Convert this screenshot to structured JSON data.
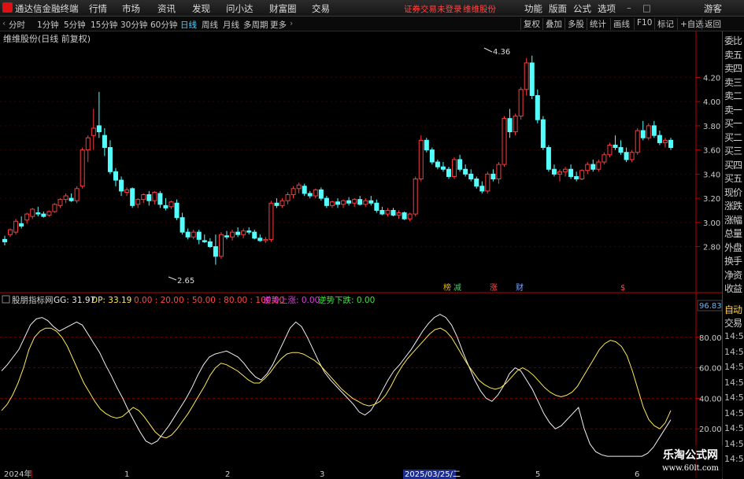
{
  "app": {
    "title": "通达信金融终端"
  },
  "menu": {
    "left": [
      "行情",
      "市场",
      "资讯",
      "发现",
      "问小达",
      "财富圈",
      "交易"
    ],
    "alert": "证券交易未登录",
    "stock": "维维股份",
    "right": [
      "功能",
      "版面",
      "公式",
      "选项"
    ],
    "user": "游客"
  },
  "periods": [
    "分时",
    "1分钟",
    "5分钟",
    "15分钟",
    "30分钟",
    "60分钟",
    "日线",
    "周线",
    "月线",
    "多周期",
    "更多"
  ],
  "active_period": "日线",
  "toolbar": [
    "复权",
    "叠加",
    "多股",
    "统计",
    "画线",
    "F10",
    "标记",
    "+自选",
    "返回"
  ],
  "side_panel": [
    "委比",
    "卖五",
    "卖四",
    "卖三",
    "卖二",
    "卖一",
    "买一",
    "买二",
    "买三",
    "买四",
    "买五",
    "现价",
    "涨跌",
    "涨幅",
    "总量",
    "外盘",
    "换手",
    "净资",
    "收益"
  ],
  "side_lower": {
    "auto": "自动",
    "trade": "交易",
    "time": "14:56"
  },
  "main_chart": {
    "title": "维维股份(日线 前复权)",
    "high_label": "4.36",
    "low_label": "2.65",
    "y_ticks": [
      "4.20",
      "4.00",
      "3.80",
      "3.60",
      "3.40",
      "3.20",
      "3.00",
      "2.80"
    ],
    "y_min": 2.55,
    "y_max": 4.45,
    "event_tags": [
      {
        "text": "榜",
        "color": "#e8b000"
      },
      {
        "text": "减",
        "color": "#44cc66"
      },
      {
        "text": "涨",
        "color": "#ff5050"
      },
      {
        "text": "财",
        "color": "#7aa6ff"
      },
      {
        "text": "$",
        "color": "#ff5050"
      }
    ]
  },
  "indicator": {
    "name": "股朋指标网",
    "gg_label": "GG: 31.97",
    "dp_label": "DP: 33.19",
    "levels_text": "0.00 : 20.00 : 50.00 : 80.00 : 100.00",
    "up_label": "逆势上涨: 0.00",
    "down_label": "逆势下跌: 0.00",
    "y_ticks": [
      "80.00",
      "60.00",
      "40.00",
      "20.00"
    ],
    "top_value": "96.83"
  },
  "x_axis": [
    "2024年",
    "1",
    "2",
    "3",
    "2025/03/25/二",
    "5",
    "6"
  ],
  "watermark": {
    "line1": "乐淘公式网",
    "line2": "www.60lt.com"
  },
  "chart_data": {
    "type": "candlestick",
    "candles": [
      [
        2.86,
        2.89,
        2.81,
        2.84
      ],
      [
        2.9,
        2.95,
        2.88,
        2.94
      ],
      [
        2.92,
        3.03,
        2.9,
        3.01
      ],
      [
        2.99,
        3.05,
        2.95,
        2.97
      ],
      [
        3.02,
        3.08,
        2.99,
        3.07
      ],
      [
        3.05,
        3.12,
        3.03,
        3.11
      ],
      [
        3.08,
        3.13,
        3.05,
        3.07
      ],
      [
        3.07,
        3.09,
        3.04,
        3.05
      ],
      [
        3.06,
        3.1,
        3.05,
        3.09
      ],
      [
        3.09,
        3.16,
        3.08,
        3.15
      ],
      [
        3.14,
        3.2,
        3.12,
        3.19
      ],
      [
        3.19,
        3.24,
        3.16,
        3.22
      ],
      [
        3.2,
        3.24,
        3.17,
        3.18
      ],
      [
        3.18,
        3.3,
        3.16,
        3.28
      ],
      [
        3.3,
        3.62,
        3.28,
        3.6
      ],
      [
        3.6,
        3.72,
        3.5,
        3.7
      ],
      [
        3.72,
        3.94,
        3.6,
        3.78
      ],
      [
        3.8,
        4.08,
        3.7,
        3.75
      ],
      [
        3.72,
        3.78,
        3.55,
        3.62
      ],
      [
        3.62,
        3.68,
        3.4,
        3.42
      ],
      [
        3.42,
        3.45,
        3.3,
        3.35
      ],
      [
        3.35,
        3.38,
        3.22,
        3.26
      ],
      [
        3.25,
        3.29,
        3.22,
        3.27
      ],
      [
        3.28,
        3.29,
        3.12,
        3.14
      ],
      [
        3.15,
        3.2,
        3.12,
        3.19
      ],
      [
        3.19,
        3.24,
        3.16,
        3.23
      ],
      [
        3.23,
        3.26,
        3.14,
        3.18
      ],
      [
        3.18,
        3.26,
        3.15,
        3.25
      ],
      [
        3.24,
        3.26,
        3.12,
        3.15
      ],
      [
        3.14,
        3.2,
        3.1,
        3.12
      ],
      [
        3.13,
        3.18,
        3.11,
        3.17
      ],
      [
        3.16,
        3.19,
        3.02,
        3.04
      ],
      [
        3.04,
        3.08,
        2.9,
        2.92
      ],
      [
        2.92,
        2.95,
        2.86,
        2.88
      ],
      [
        2.88,
        2.94,
        2.86,
        2.92
      ],
      [
        2.92,
        2.94,
        2.82,
        2.86
      ],
      [
        2.85,
        2.9,
        2.83,
        2.84
      ],
      [
        2.84,
        2.87,
        2.79,
        2.8
      ],
      [
        2.8,
        2.9,
        2.65,
        2.72
      ],
      [
        2.72,
        2.92,
        2.7,
        2.9
      ],
      [
        2.89,
        2.93,
        2.86,
        2.88
      ],
      [
        2.88,
        2.94,
        2.85,
        2.92
      ],
      [
        2.92,
        2.96,
        2.88,
        2.9
      ],
      [
        2.9,
        2.95,
        2.87,
        2.93
      ],
      [
        2.93,
        2.96,
        2.9,
        2.92
      ],
      [
        2.92,
        2.94,
        2.86,
        2.87
      ],
      [
        2.87,
        2.9,
        2.84,
        2.85
      ],
      [
        2.85,
        2.88,
        2.83,
        2.86
      ],
      [
        2.86,
        3.18,
        2.84,
        3.16
      ],
      [
        3.16,
        3.2,
        3.12,
        3.14
      ],
      [
        3.14,
        3.2,
        3.12,
        3.18
      ],
      [
        3.18,
        3.25,
        3.15,
        3.23
      ],
      [
        3.23,
        3.3,
        3.2,
        3.28
      ],
      [
        3.28,
        3.33,
        3.24,
        3.31
      ],
      [
        3.3,
        3.32,
        3.22,
        3.24
      ],
      [
        3.24,
        3.26,
        3.2,
        3.22
      ],
      [
        3.22,
        3.28,
        3.2,
        3.27
      ],
      [
        3.27,
        3.29,
        3.18,
        3.2
      ],
      [
        3.2,
        3.22,
        3.12,
        3.14
      ],
      [
        3.14,
        3.18,
        3.12,
        3.17
      ],
      [
        3.17,
        3.2,
        3.12,
        3.15
      ],
      [
        3.15,
        3.19,
        3.12,
        3.18
      ],
      [
        3.18,
        3.21,
        3.14,
        3.16
      ],
      [
        3.16,
        3.2,
        3.13,
        3.19
      ],
      [
        3.19,
        3.22,
        3.14,
        3.15
      ],
      [
        3.15,
        3.2,
        3.13,
        3.18
      ],
      [
        3.18,
        3.22,
        3.14,
        3.16
      ],
      [
        3.16,
        3.19,
        3.08,
        3.1
      ],
      [
        3.1,
        3.13,
        3.06,
        3.07
      ],
      [
        3.07,
        3.12,
        3.05,
        3.1
      ],
      [
        3.1,
        3.12,
        3.05,
        3.06
      ],
      [
        3.06,
        3.1,
        3.03,
        3.08
      ],
      [
        3.08,
        3.09,
        3.02,
        3.03
      ],
      [
        3.03,
        3.08,
        3.01,
        3.07
      ],
      [
        3.07,
        3.38,
        3.05,
        3.36
      ],
      [
        3.36,
        3.72,
        3.34,
        3.68
      ],
      [
        3.68,
        3.7,
        3.58,
        3.6
      ],
      [
        3.6,
        3.62,
        3.48,
        3.5
      ],
      [
        3.5,
        3.52,
        3.44,
        3.46
      ],
      [
        3.46,
        3.5,
        3.42,
        3.44
      ],
      [
        3.44,
        3.46,
        3.36,
        3.38
      ],
      [
        3.38,
        3.54,
        3.36,
        3.52
      ],
      [
        3.52,
        3.56,
        3.42,
        3.44
      ],
      [
        3.44,
        3.48,
        3.38,
        3.4
      ],
      [
        3.4,
        3.44,
        3.34,
        3.36
      ],
      [
        3.36,
        3.38,
        3.28,
        3.3
      ],
      [
        3.3,
        3.34,
        3.24,
        3.26
      ],
      [
        3.26,
        3.42,
        3.24,
        3.4
      ],
      [
        3.4,
        3.44,
        3.34,
        3.36
      ],
      [
        3.36,
        3.5,
        3.32,
        3.48
      ],
      [
        3.48,
        3.88,
        3.46,
        3.86
      ],
      [
        3.86,
        3.94,
        3.7,
        3.75
      ],
      [
        3.75,
        3.9,
        3.72,
        3.88
      ],
      [
        3.88,
        4.12,
        3.85,
        4.1
      ],
      [
        4.1,
        4.36,
        4.05,
        4.32
      ],
      [
        4.32,
        4.38,
        4.02,
        4.05
      ],
      [
        4.05,
        4.1,
        3.82,
        3.85
      ],
      [
        3.85,
        3.88,
        3.6,
        3.62
      ],
      [
        3.62,
        3.64,
        3.42,
        3.44
      ],
      [
        3.44,
        3.48,
        3.38,
        3.4
      ],
      [
        3.4,
        3.44,
        3.34,
        3.42
      ],
      [
        3.42,
        3.46,
        3.38,
        3.44
      ],
      [
        3.44,
        3.48,
        3.36,
        3.38
      ],
      [
        3.38,
        3.42,
        3.34,
        3.36
      ],
      [
        3.36,
        3.44,
        3.35,
        3.43
      ],
      [
        3.43,
        3.5,
        3.4,
        3.48
      ],
      [
        3.48,
        3.52,
        3.42,
        3.44
      ],
      [
        3.44,
        3.52,
        3.42,
        3.5
      ],
      [
        3.5,
        3.58,
        3.48,
        3.56
      ],
      [
        3.56,
        3.66,
        3.54,
        3.64
      ],
      [
        3.64,
        3.72,
        3.6,
        3.62
      ],
      [
        3.62,
        3.68,
        3.56,
        3.58
      ],
      [
        3.58,
        3.62,
        3.5,
        3.52
      ],
      [
        3.52,
        3.6,
        3.5,
        3.58
      ],
      [
        3.58,
        3.78,
        3.56,
        3.76
      ],
      [
        3.76,
        3.84,
        3.68,
        3.7
      ],
      [
        3.7,
        3.82,
        3.68,
        3.8
      ],
      [
        3.8,
        3.84,
        3.7,
        3.72
      ],
      [
        3.72,
        3.76,
        3.64,
        3.66
      ],
      [
        3.66,
        3.7,
        3.62,
        3.68
      ],
      [
        3.68,
        3.7,
        3.6,
        3.62
      ]
    ],
    "gg_line": [
      58,
      62,
      67,
      72,
      80,
      88,
      92,
      93,
      91,
      87,
      84,
      86,
      88,
      90,
      88,
      82,
      76,
      70,
      62,
      55,
      47,
      40,
      32,
      25,
      18,
      12,
      10,
      12,
      17,
      22,
      28,
      34,
      40,
      47,
      55,
      62,
      67,
      69,
      70,
      71,
      69,
      67,
      63,
      58,
      54,
      52,
      56,
      62,
      70,
      78,
      86,
      90,
      87,
      80,
      72,
      64,
      57,
      52,
      48,
      44,
      40,
      36,
      31,
      29,
      32,
      38,
      45,
      52,
      58,
      62,
      67,
      72,
      78,
      84,
      89,
      93,
      95,
      93,
      88,
      80,
      70,
      61,
      52,
      45,
      40,
      38,
      42,
      48,
      56,
      60,
      58,
      52,
      46,
      38,
      30,
      24,
      20,
      22,
      26,
      30,
      34,
      20,
      10,
      5,
      3,
      2,
      2,
      2,
      2,
      2,
      2,
      2,
      4,
      8,
      14,
      20,
      26
    ],
    "dp_line": [
      32,
      36,
      42,
      50,
      60,
      72,
      80,
      84,
      86,
      86,
      84,
      80,
      74,
      66,
      58,
      50,
      44,
      38,
      33,
      30,
      28,
      27,
      28,
      31,
      34,
      32,
      28,
      23,
      18,
      15,
      14,
      16,
      20,
      25,
      30,
      36,
      42,
      48,
      55,
      60,
      63,
      62,
      60,
      58,
      55,
      52,
      50,
      50,
      53,
      57,
      62,
      66,
      69,
      70,
      70,
      69,
      67,
      65,
      62,
      58,
      54,
      50,
      46,
      43,
      40,
      38,
      36,
      35,
      36,
      38,
      42,
      48,
      55,
      61,
      66,
      70,
      74,
      78,
      82,
      85,
      86,
      84,
      80,
      74,
      68,
      62,
      57,
      52,
      49,
      47,
      46,
      47,
      50,
      54,
      58,
      60,
      58,
      55,
      51,
      47,
      44,
      42,
      41,
      42,
      44,
      48,
      54,
      60,
      66,
      72,
      76,
      78,
      77,
      74,
      68,
      58,
      46,
      34,
      26,
      22,
      20,
      24,
      32
    ]
  }
}
